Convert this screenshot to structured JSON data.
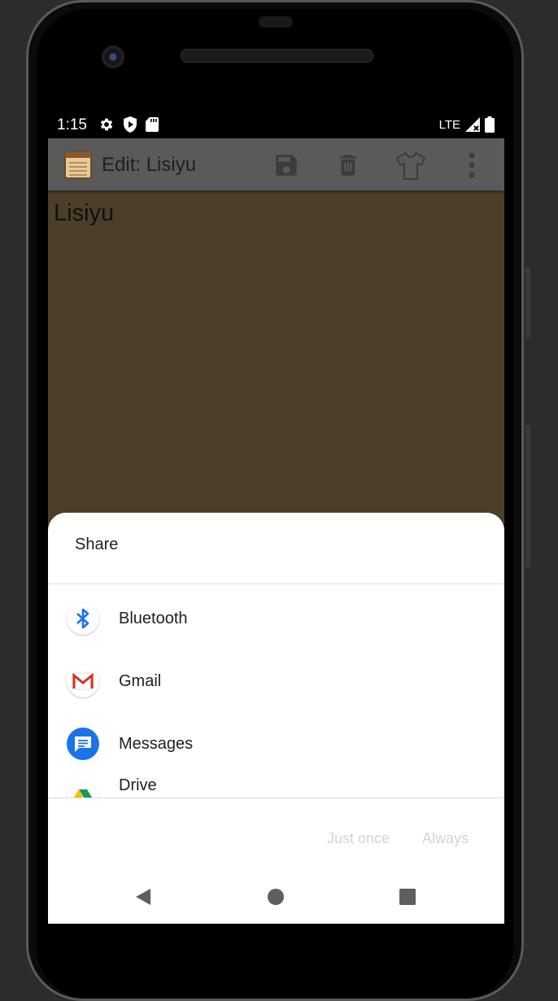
{
  "status_bar": {
    "time": "1:15",
    "network": "LTE",
    "icons": [
      "gear-icon",
      "shield-play-icon",
      "sd-card-icon",
      "signal-icon",
      "battery-icon"
    ]
  },
  "app_bar": {
    "title": "Edit: Lisiyu",
    "actions": [
      "save-icon",
      "delete-icon",
      "theme-shirt-icon",
      "overflow-menu-icon"
    ]
  },
  "note": {
    "body": "Lisiyu"
  },
  "share_sheet": {
    "title": "Share",
    "items": [
      {
        "label": "Bluetooth",
        "icon": "bluetooth-icon"
      },
      {
        "label": "Gmail",
        "icon": "gmail-icon"
      },
      {
        "label": "Messages",
        "icon": "messages-icon"
      },
      {
        "label": "Drive",
        "icon": "drive-icon"
      }
    ],
    "just_once_label": "Just once",
    "always_label": "Always"
  },
  "navigation": [
    "back-icon",
    "home-icon",
    "recents-icon"
  ],
  "colors": {
    "note_background": "#4b3f29",
    "app_bar": "#5a5a5a",
    "bluetooth": "#1a73e8",
    "messages": "#1a73e8",
    "gmail_red": "#d93025",
    "disabled_text": "#d3d3d3"
  }
}
